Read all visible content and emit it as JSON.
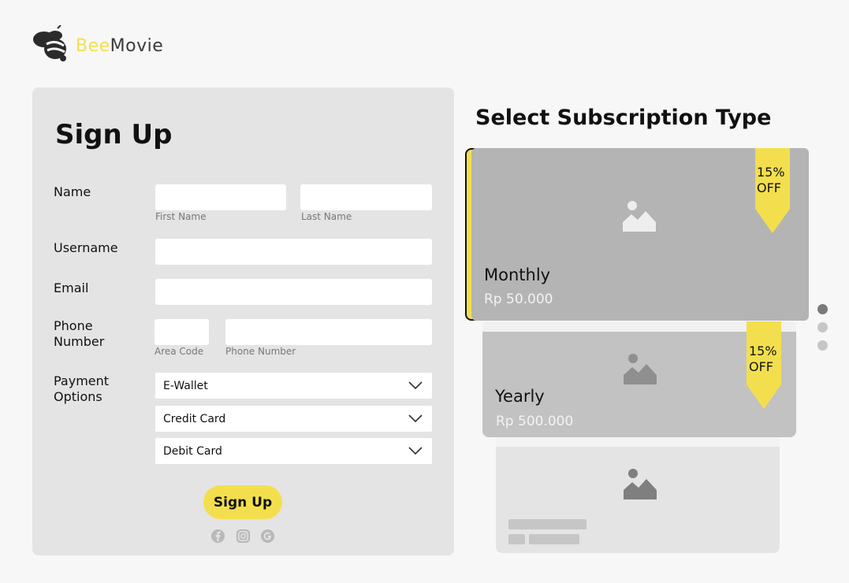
{
  "brand": {
    "name_part1": "Bee",
    "name_part2": "Movie",
    "accent_color": "#f3df4d"
  },
  "form": {
    "title": "Sign Up",
    "name_label": "Name",
    "first_name_hint": "First Name",
    "last_name_hint": "Last Name",
    "username_label": "Username",
    "email_label": "Email",
    "phone_label_line1": "Phone",
    "phone_label_line2": "Number",
    "area_code_hint": "Area Code",
    "phone_number_hint": "Phone Number",
    "payment_label_line1": "Payment",
    "payment_label_line2": "Options",
    "payment_options": [
      "E-Wallet",
      "Credit Card",
      "Debit Card"
    ],
    "submit_label": "Sign Up",
    "social_icons": [
      "facebook-icon",
      "instagram-icon",
      "google-icon"
    ]
  },
  "subscription": {
    "title": "Select Subscription Type",
    "plans": [
      {
        "name": "Monthly",
        "price": "Rp 50.000",
        "discount_line1": "15%",
        "discount_line2": "OFF"
      },
      {
        "name": "Yearly",
        "price": "Rp 500.000",
        "discount_line1": "15%",
        "discount_line2": "OFF"
      }
    ],
    "pagination": {
      "total": 3,
      "active": 1
    }
  }
}
